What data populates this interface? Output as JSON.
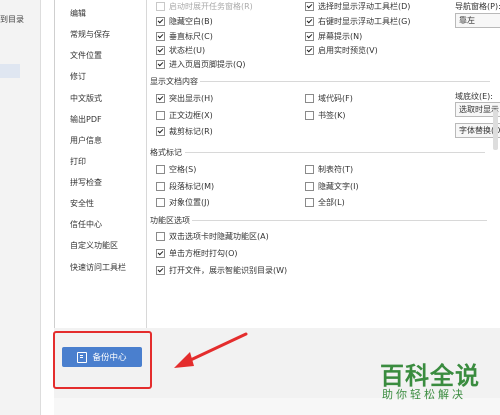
{
  "background_app": {
    "sidebar_text": "到目录"
  },
  "nav": {
    "items": [
      "编辑",
      "常规与保存",
      "文件位置",
      "修订",
      "中文版式",
      "输出PDF",
      "用户信息",
      "打印",
      "拼写检查",
      "安全性",
      "信任中心",
      "自定义功能区",
      "快速访问工具栏"
    ]
  },
  "view": {
    "top_left": [
      {
        "label": "启动时展开任务窗格(R)",
        "checked": false,
        "dim": true
      },
      {
        "label": "隐藏空白(B)",
        "checked": true
      },
      {
        "label": "垂直标尺(C)",
        "checked": true
      },
      {
        "label": "状态栏(U)",
        "checked": true
      },
      {
        "label": "进入页眉页脚提示(Q)",
        "checked": true
      }
    ],
    "top_right": [
      {
        "label": "选择时显示浮动工具栏(D)",
        "checked": true
      },
      {
        "label": "右键时显示浮动工具栏(G)",
        "checked": true
      },
      {
        "label": "屏幕提示(N)",
        "checked": true
      },
      {
        "label": "启用实时预览(V)",
        "checked": true
      }
    ],
    "nav_pane_label": "导航窗格(P):",
    "nav_pane_value": "靠左",
    "section_doc": "显示文档内容",
    "doc_left": [
      {
        "label": "突出显示(H)",
        "checked": true
      },
      {
        "label": "正文边框(X)",
        "checked": false
      },
      {
        "label": "裁剪标记(R)",
        "checked": true
      }
    ],
    "doc_right": [
      {
        "label": "域代码(F)",
        "checked": false
      },
      {
        "label": "书签(K)",
        "checked": false
      }
    ],
    "field_shading_label": "域底纹(E):",
    "field_shading_value": "选取时显示",
    "font_replace_label": "字体替换(O)...",
    "section_marks": "格式标记",
    "marks_left": [
      {
        "label": "空格(S)",
        "checked": false
      },
      {
        "label": "段落标记(M)",
        "checked": false
      },
      {
        "label": "对象位置(J)",
        "checked": false
      }
    ],
    "marks_right": [
      {
        "label": "制表符(T)",
        "checked": false
      },
      {
        "label": "隐藏文字(I)",
        "checked": false
      },
      {
        "label": "全部(L)",
        "checked": false
      }
    ],
    "section_ribbon": "功能区选项",
    "ribbon": [
      {
        "label": "双击选项卡时隐藏功能区(A)",
        "checked": false
      },
      {
        "label": "单击方框时打勾(O)",
        "checked": true
      },
      {
        "label": "打开文件，展示智能识别目录(W)",
        "checked": true
      }
    ]
  },
  "footer": {
    "backup_label": "备份中心"
  },
  "watermark": {
    "main": "百科全说",
    "sub": "助你轻松解决"
  },
  "colors": {
    "highlight_box": "#e42d2d",
    "button_blue": "#4a7fce",
    "watermark_green": "#3a8c3f"
  }
}
